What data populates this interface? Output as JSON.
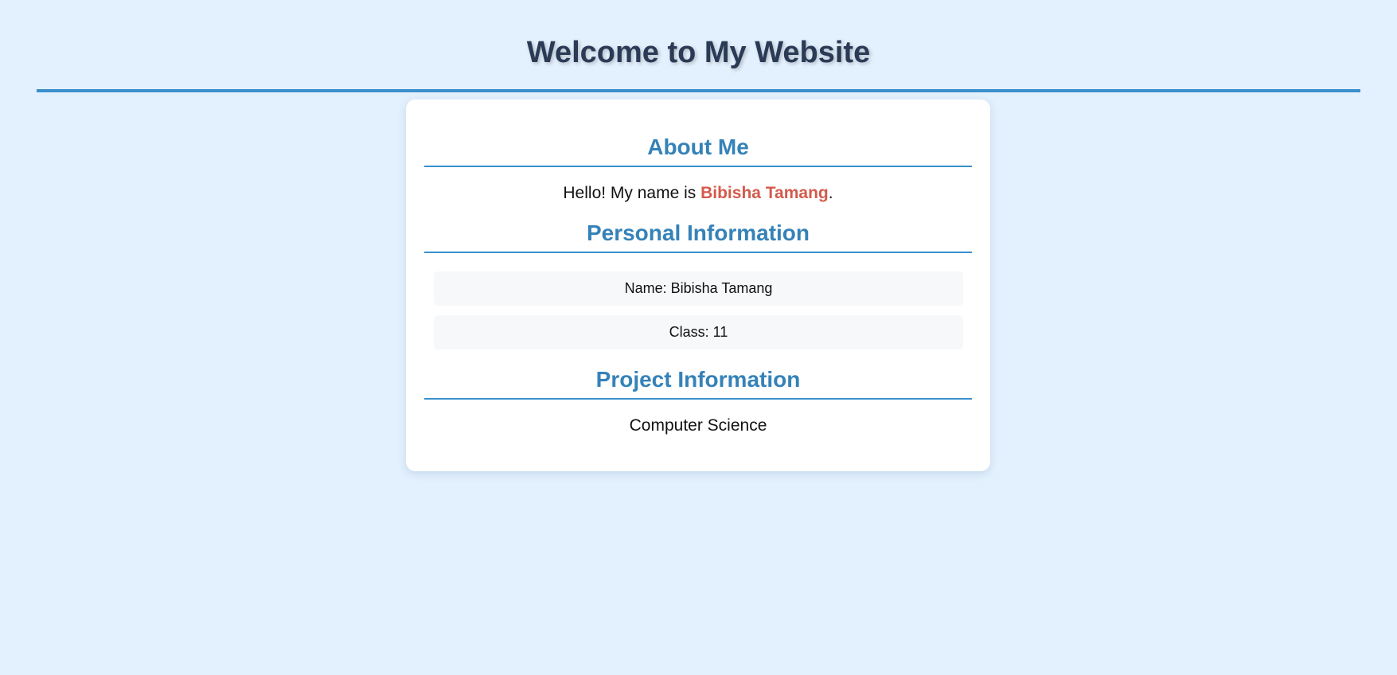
{
  "header": {
    "title": "Welcome to My Website"
  },
  "about": {
    "heading": "About Me",
    "intro_prefix": "Hello! My name is ",
    "name_highlight": "Bibisha Tamang",
    "intro_suffix": "."
  },
  "personal": {
    "heading": "Personal Information",
    "items": [
      {
        "text": "Name: Bibisha Tamang"
      },
      {
        "text": "Class: 11"
      }
    ]
  },
  "project": {
    "heading": "Project Information",
    "text": "Computer Science"
  },
  "colors": {
    "background": "#e3f0fd",
    "accent": "#3a8fcb",
    "heading": "#3582b8",
    "title": "#2b3a55",
    "highlight": "#d35a4c"
  }
}
